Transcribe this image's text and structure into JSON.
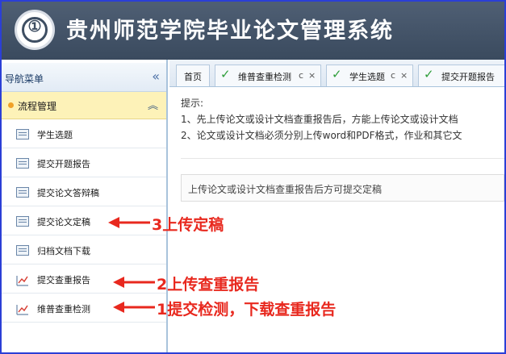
{
  "header": {
    "logo_text": "①",
    "title": "贵州师范学院毕业论文管理系统"
  },
  "sidebar": {
    "title": "导航菜单",
    "collapse_icon": "double-chevron-left",
    "group": {
      "label": "流程管理",
      "chevron_icon": "double-chevron-up"
    },
    "items": [
      {
        "label": "学生选题",
        "icon": "list-icon"
      },
      {
        "label": "提交开题报告",
        "icon": "list-icon"
      },
      {
        "label": "提交论文答辩稿",
        "icon": "list-icon"
      },
      {
        "label": "提交论文定稿",
        "icon": "list-icon"
      },
      {
        "label": "归档文档下载",
        "icon": "list-icon"
      },
      {
        "label": "提交查重报告",
        "icon": "chart-icon"
      },
      {
        "label": "维普查重检测",
        "icon": "chart-icon"
      }
    ]
  },
  "tabs": [
    {
      "label": "首页",
      "closable": false
    },
    {
      "label": "维普查重检测",
      "closable": true
    },
    {
      "label": "学生选题",
      "closable": true
    },
    {
      "label": "提交开题报告",
      "closable": true
    }
  ],
  "tab_controls": {
    "refresh": "c",
    "close": "×"
  },
  "content": {
    "tips_title": "提示:",
    "tip1": "1、先上传论文或设计文档查重报告后，方能上传论文或设计文档",
    "tip2": "2、论文或设计文档必须分别上传word和PDF格式，作业和其它文",
    "notice": "上传论文或设计文档查重报告后方可提交定稿"
  },
  "annotations": {
    "a3": "3上传定稿",
    "a2": "2上传查重报告",
    "a1": "1提交检测，下载查重报告"
  },
  "colors": {
    "header_bg": "#44546a",
    "accent_blue": "#2b3fd6",
    "group_bg": "#fdf2b8",
    "annotation_red": "#e8281e",
    "check_green": "#2e9e3a"
  }
}
